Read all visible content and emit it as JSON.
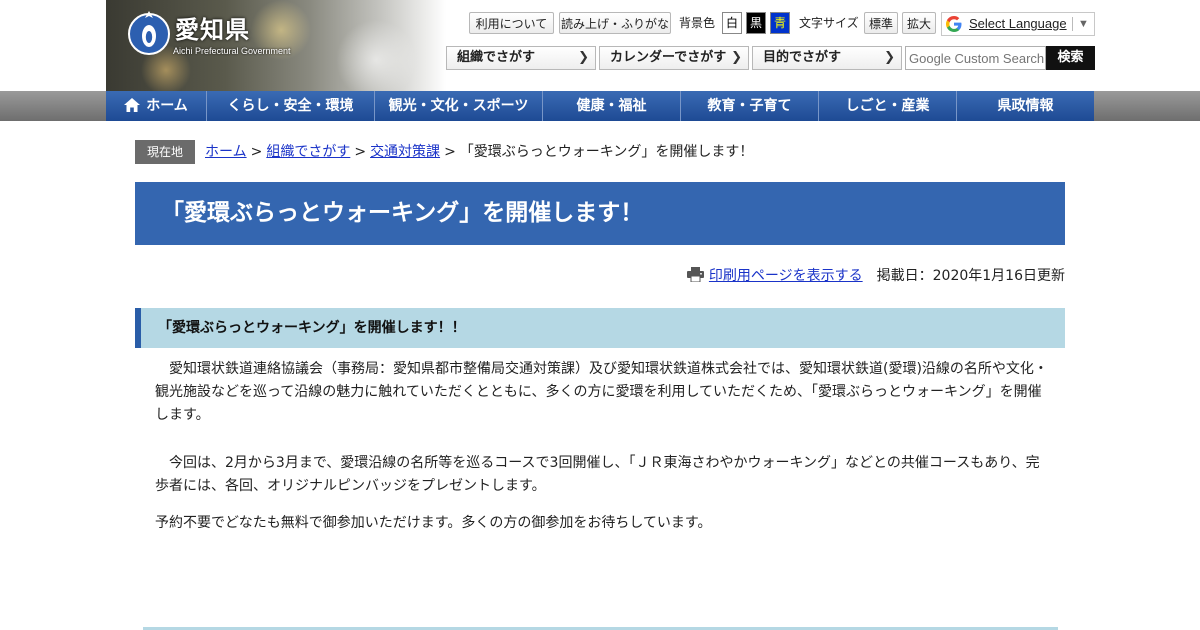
{
  "header": {
    "logo_title": "愛知県",
    "logo_subtitle": "Aichi Prefectural Government",
    "util_links": [
      "利用について",
      "読み上げ・ふりがな"
    ],
    "bg_color_label": "背景色",
    "bg_colors": [
      {
        "label": "白",
        "bg": "#ffffff",
        "fg": "#000000"
      },
      {
        "label": "黒",
        "bg": "#000000",
        "fg": "#ffffff"
      },
      {
        "label": "青",
        "bg": "#0033cc",
        "fg": "#ffff00"
      }
    ],
    "font_size_label": "文字サイズ",
    "font_sizes": [
      "標準",
      "拡大"
    ],
    "translate_label": "Select Language",
    "nav_buttons": [
      "組織でさがす",
      "カレンダーでさがす",
      "目的でさがす"
    ],
    "search_placeholder": "Google Custom Search",
    "search_button": "検索"
  },
  "global_nav": [
    "ホーム",
    "くらし・安全・環境",
    "観光・文化・スポーツ",
    "健康・福祉",
    "教育・子育て",
    "しごと・産業",
    "県政情報"
  ],
  "breadcrumb": {
    "label": "現在地",
    "links": [
      "ホーム",
      "組織でさがす",
      "交通対策課"
    ],
    "current": "「愛環ぶらっとウォーキング」を開催します！",
    "separator": ">"
  },
  "page_title": "「愛環ぶらっとウォーキング」を開催します！",
  "print_link": "印刷用ページを表示する",
  "posted_date": "掲載日：2020年1月16日更新",
  "section_heading": "「愛環ぶらっとウォーキング」を開催します！！",
  "paragraphs": [
    "　愛知環状鉄道連絡協議会（事務局：愛知県都市整備局交通対策課）及び愛知環状鉄道株式会社では、愛知環状鉄道(愛環)沿線の名所や文化・観光施設などを巡って沿線の魅力に触れていただくとともに、多くの方に愛環を利用していただくため、「愛環ぶらっとウォーキング」を開催します。",
    "　今回は、2月から3月まで、愛環沿線の名所等を巡るコースで3回開催し、「ＪＲ東海さわやかウォーキング」などとの共催コースもあり、完歩者には、各回、オリジナルピンバッジをプレゼントします。",
    "予約不要でどなたも無料で御参加いただけます。多くの方の御参加をお待ちしています。"
  ],
  "colors": {
    "brand_blue": "#3466b0",
    "nav_blue": "#1e4a94",
    "section_bg": "#b5d8e4",
    "link": "#1a33c8"
  }
}
